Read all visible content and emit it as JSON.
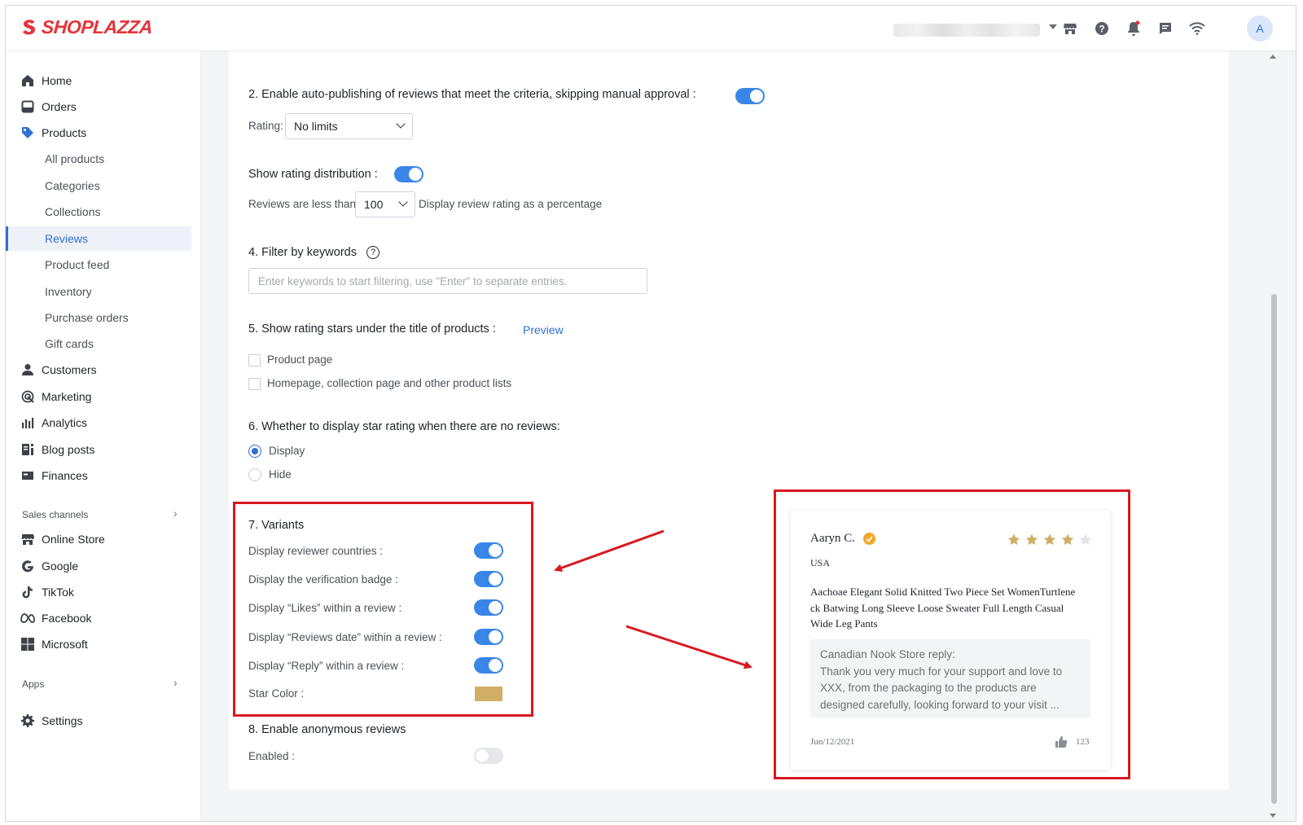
{
  "brand": {
    "name": "SHOPLAZZA",
    "color": "#e4333a"
  },
  "topbar": {
    "icons": [
      "store-icon",
      "help-icon",
      "bell-icon",
      "chat-icon",
      "wifi-icon"
    ],
    "avatar_letter": "A"
  },
  "sidebar": {
    "items": [
      {
        "label": "Home",
        "icon": "home-icon"
      },
      {
        "label": "Orders",
        "icon": "orders-icon"
      },
      {
        "label": "Products",
        "icon": "tag-icon"
      }
    ],
    "product_sub": [
      "All products",
      "Categories",
      "Collections",
      "Reviews",
      "Product feed",
      "Inventory",
      "Purchase orders",
      "Gift cards"
    ],
    "items2": [
      {
        "label": "Customers",
        "icon": "person-icon"
      },
      {
        "label": "Marketing",
        "icon": "marketing-icon"
      },
      {
        "label": "Analytics",
        "icon": "chart-icon"
      },
      {
        "label": "Blog posts",
        "icon": "blog-icon"
      },
      {
        "label": "Finances",
        "icon": "finance-icon"
      }
    ],
    "sales_channels_title": "Sales channels",
    "channels": [
      {
        "label": "Online Store",
        "icon": "store-icon"
      },
      {
        "label": "Google",
        "icon": "google-icon"
      },
      {
        "label": "TikTok",
        "icon": "tiktok-icon"
      },
      {
        "label": "Facebook",
        "icon": "meta-icon"
      },
      {
        "label": "Microsoft",
        "icon": "microsoft-icon"
      }
    ],
    "apps_title": "Apps",
    "settings_label": "Settings",
    "active_item": "Reviews"
  },
  "settings": {
    "autopublish_label": "2. Enable auto-publishing of reviews that meet the criteria, skipping manual approval :",
    "autopublish_on": true,
    "rating_label": "Rating:",
    "rating_value": "No limits",
    "distribution_label": "Show rating distribution :",
    "distribution_on": true,
    "reviews_less_than": "Reviews are less than",
    "threshold_value": "100",
    "display_percentage": "Display review rating as a percentage",
    "filter_label": "4. Filter by keywords",
    "filter_placeholder": "Enter keywords to start filtering, use \"Enter\" to separate entries.",
    "stars_label": "5. Show rating stars under the title of products :",
    "preview_link": "Preview",
    "product_page": "Product page",
    "homepage_lists": "Homepage, collection page and other product lists",
    "no_reviews_label": "6. Whether to display star rating when there are no reviews:",
    "display_option": "Display",
    "hide_option": "Hide",
    "variants_title": "7. Variants",
    "variants": [
      {
        "label": "Display reviewer countries :",
        "on": true
      },
      {
        "label": "Display the verification badge :",
        "on": true
      },
      {
        "label": "Display “Likes” within a review :",
        "on": true
      },
      {
        "label": "Display “Reviews date” within a review :",
        "on": true
      },
      {
        "label": "Display “Reply” within a review :",
        "on": true
      }
    ],
    "star_color_label": "Star Color :",
    "star_color": "#cfae66",
    "anonymous_title": "8. Enable anonymous reviews",
    "enabled_label": "Enabled :",
    "anonymous_on": false
  },
  "preview_card": {
    "reviewer": "Aaryn C.",
    "country": "USA",
    "rating": 4,
    "max_rating": 5,
    "review_text": "Aachoae Elegant Solid Knitted Two Piece Set WomenTurtleneck Batwing Long Sleeve Loose Sweater Full  Length Casual Wide Leg Pants",
    "review_lines": [
      "Aachoae Elegant Solid Knitted Two Piece Set WomenTurtlene",
      "ck Batwing Long Sleeve Loose Sweater Full  Length Casual",
      "Wide Leg Pants"
    ],
    "reply_title": "Canadian Nook Store reply:",
    "reply_lines": [
      "Thank you very much for your support and love to",
      "XXX, from the packaging to the products are",
      "designed carefully, looking forward to your visit ..."
    ],
    "date": "Jun/12/2021",
    "likes": "123"
  },
  "colors": {
    "accent": "#2f6fd6",
    "highlight": "#d71920",
    "badge": "#f5a623"
  }
}
